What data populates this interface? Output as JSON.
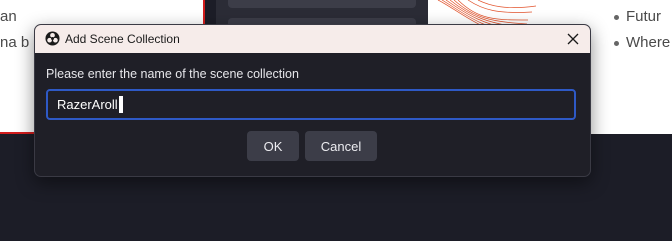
{
  "background": {
    "left_lines": [
      "an",
      "na b"
    ],
    "right_bullets": [
      "Futur",
      "Where"
    ]
  },
  "dialog": {
    "title": "Add Scene Collection",
    "prompt": "Please enter the name of the scene collection",
    "input_value": "RazerAroll",
    "ok_label": "OK",
    "cancel_label": "Cancel",
    "icons": {
      "app": "obs-logo-icon",
      "close": "close-icon"
    },
    "colors": {
      "titlebar": "#f6ecea",
      "body": "#1f1f27",
      "input_border": "#2e59c6",
      "button": "#3c3d48"
    }
  }
}
